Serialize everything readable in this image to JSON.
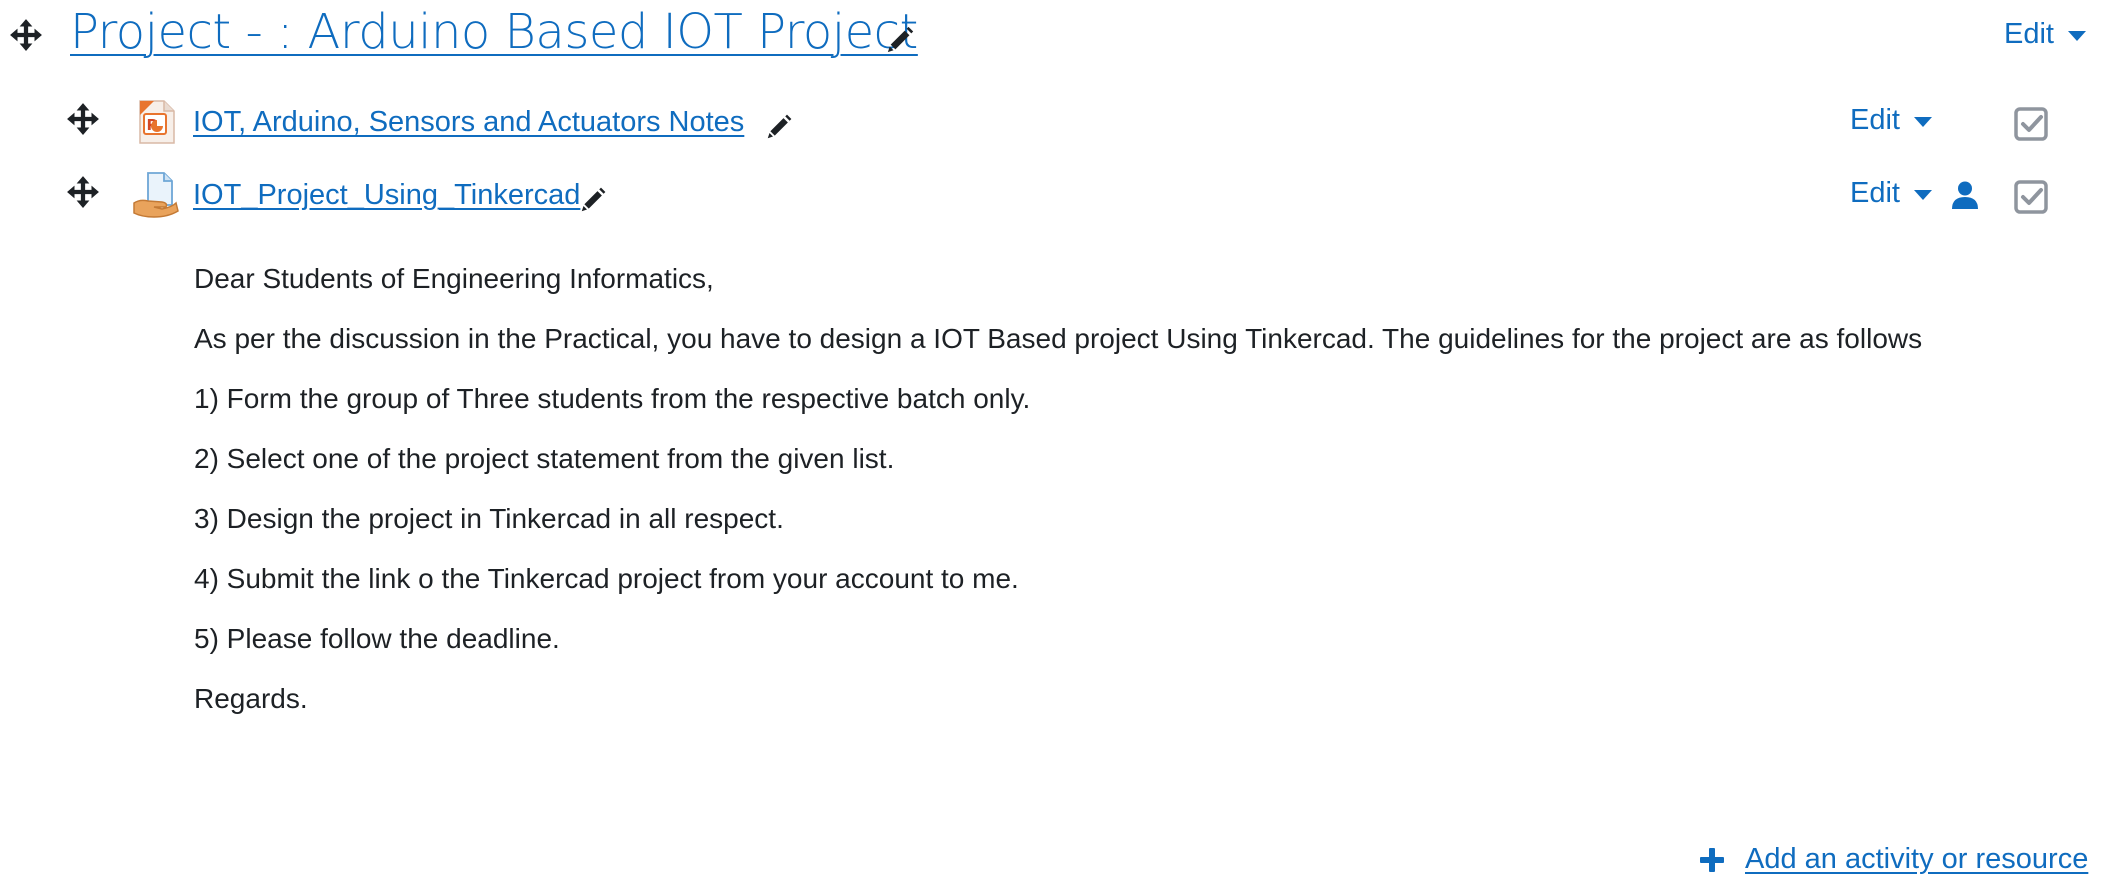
{
  "section": {
    "title": "Project - : Arduino Based IOT Project",
    "edit_label": "Edit",
    "move_icon": "move-icon",
    "pencil_icon": "pencil-icon"
  },
  "activities": [
    {
      "name": "IOT, Arduino, Sensors and Actuators Notes",
      "type_icon": "powerpoint-file-icon",
      "edit_label": "Edit",
      "has_restriction_icon": false,
      "completion": "checked"
    },
    {
      "name": "IOT_Project_Using_Tinkercad",
      "type_icon": "assignment-icon",
      "edit_label": "Edit",
      "has_restriction_icon": true,
      "restriction_icon": "user-icon",
      "completion": "checked"
    }
  ],
  "description": {
    "greeting": "Dear Students of Engineering Informatics,",
    "intro": "As per the discussion in the Practical, you have to design a IOT Based project Using Tinkercad. The guidelines for the project are as follows",
    "items": [
      "1) Form the group of Three students from the respective batch only.",
      "2) Select one of the project statement from the given list.",
      "3) Design the project in Tinkercad in all respect.",
      "4) Submit the link o the Tinkercad project from your account to me.",
      "5) Please follow the deadline."
    ],
    "closing": "Regards."
  },
  "footer": {
    "add_label": "Add an activity or resource",
    "add_icon": "plus-icon"
  },
  "colors": {
    "link": "#0f6cbf",
    "text": "#1d2125",
    "icon_dark": "#1d2125",
    "completion_gray": "#8f959e"
  }
}
